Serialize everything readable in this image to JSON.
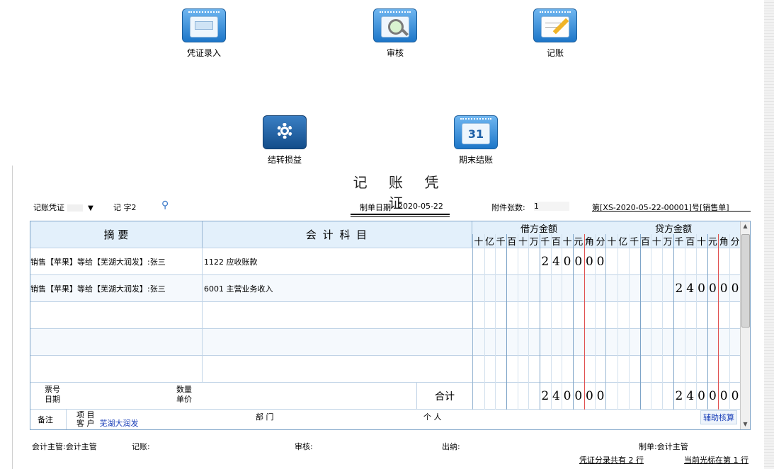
{
  "toolbar": [
    {
      "label": "凭证录入",
      "icon": "voucher-entry-icon"
    },
    {
      "label": "审核",
      "icon": "audit-icon"
    },
    {
      "label": "记账",
      "icon": "posting-icon"
    },
    {
      "label": "结转损益",
      "icon": "gear-icon"
    },
    {
      "label": "期末结账",
      "icon": "calendar-icon",
      "badge": "31"
    }
  ],
  "voucher": {
    "title": "记 账 凭 证",
    "type_select": "记账凭证",
    "word_no": "记 字2",
    "date_label": "制单日期",
    "date": "2020-05-22",
    "attach_label": "附件张数:",
    "attach_count": "1",
    "ref": "第[XS-2020-05-22-00001]号[销售单]",
    "headers": {
      "summary": "摘   要",
      "account": "会 计 科 目",
      "debit": "借方金额",
      "credit": "贷方金额",
      "digits": [
        "十",
        "亿",
        "千",
        "百",
        "十",
        "万",
        "千",
        "百",
        "十",
        "元",
        "角",
        "分"
      ]
    },
    "rows": [
      {
        "summary": "销售【苹果】等给【芜湖大润发】:张三",
        "account": "1122 应收账款",
        "debit": "240000",
        "credit": ""
      },
      {
        "summary": "销售【苹果】等给【芜湖大润发】:张三",
        "account": "6001 主营业务收入",
        "debit": "",
        "credit": "240000"
      },
      {
        "summary": "",
        "account": "",
        "debit": "",
        "credit": ""
      },
      {
        "summary": "",
        "account": "",
        "debit": "",
        "credit": ""
      },
      {
        "summary": "",
        "account": "",
        "debit": "",
        "credit": ""
      }
    ],
    "total": {
      "bill_no_label": "票号",
      "date_label": "日期",
      "qty_label": "数量",
      "price_label": "单价",
      "label": "合计",
      "debit": "240000",
      "credit": "240000"
    },
    "notes": {
      "label": "备注",
      "project_label": "项 目",
      "customer_label": "客 户",
      "customer_value": "芜湖大润发",
      "dept_label": "部 门",
      "person_label": "个 人",
      "aux_button": "辅助核算"
    }
  },
  "footer": {
    "supervisor": "会计主管:会计主管",
    "posting": "记账:",
    "audit": "审核:",
    "cashier": "出纳:",
    "maker": "制单:会计主管",
    "entry_count": "凭证分录共有 2 行",
    "cursor_row": "当前光标在第 1 行"
  },
  "colors": {
    "grid_blue": "#7ea4c8",
    "header_bg": "#e3f0fb",
    "red_line": "#e05050",
    "link_blue": "#1a3fb8"
  }
}
